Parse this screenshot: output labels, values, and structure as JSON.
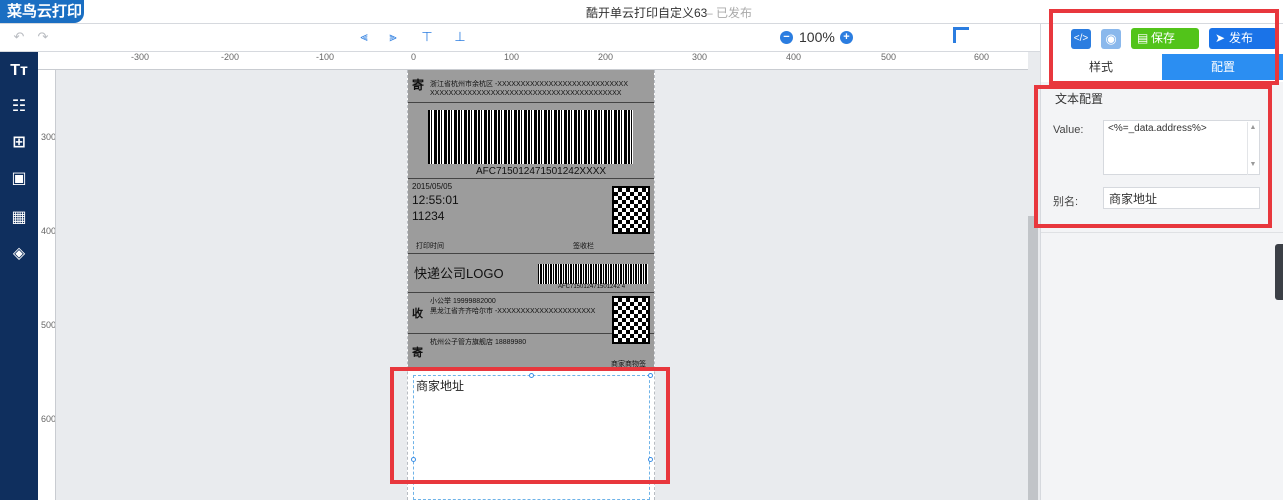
{
  "app": {
    "brand": "菜鸟云打印",
    "doc_title": "酷开单云打印自定义63",
    "doc_status": "– 已发布"
  },
  "toolbar": {
    "zoom": "100%",
    "zoom_out": "−",
    "zoom_in": "+"
  },
  "ruler": {
    "h_labels": [
      "-300",
      "-200",
      "-100",
      "0",
      "100",
      "200",
      "300",
      "400",
      "500",
      "600"
    ],
    "v_labels": [
      "300",
      "400",
      "500",
      "600"
    ]
  },
  "waybill": {
    "barcode_text": "AFC715012471501242XXXX",
    "date": "2015/05/05",
    "time": "12:55:01",
    "code": "11234",
    "logo": "快递公司LOGO",
    "barcode_small_text": "AFC715012471501242 4",
    "send_glyph": "寄",
    "recv_glyph": "收",
    "sender_line": "浙江省杭州市余杭区 -XXXXXXXXXXXXXXXXXXXXXXXXXXXX",
    "filler_line": "XXXXXXXXXXXXXXXXXXXXXXXXXXXXXXXXXXXXXXXXX",
    "recv_phone": "小公举  19999882000",
    "recv_addr": "黑龙江省齐齐哈尔市 -XXXXXXXXXXXXXXXXXXXXX",
    "send_name": "杭州公子管方旗舰店  18889980",
    "print_time": "打印时间",
    "sign": "签收栏",
    "item_label": "商家商物签"
  },
  "selected_element": {
    "value": "商家地址"
  },
  "panel": {
    "code_icon": "</>",
    "eye_icon": "◉",
    "save": "保存",
    "publish": "发布",
    "tab_style": "样式",
    "tab_config": "配置",
    "section_title": "文本配置",
    "value_label": "Value:",
    "value_text": "<%=_data.address%>",
    "alias_label": "别名:",
    "alias_value": "商家地址"
  },
  "colors": {
    "accent": "#2b7de0",
    "sidebar": "#0f2f5e",
    "save_green": "#52c41a",
    "publish_blue": "#1a73e8",
    "highlight_red": "#e8373d"
  }
}
